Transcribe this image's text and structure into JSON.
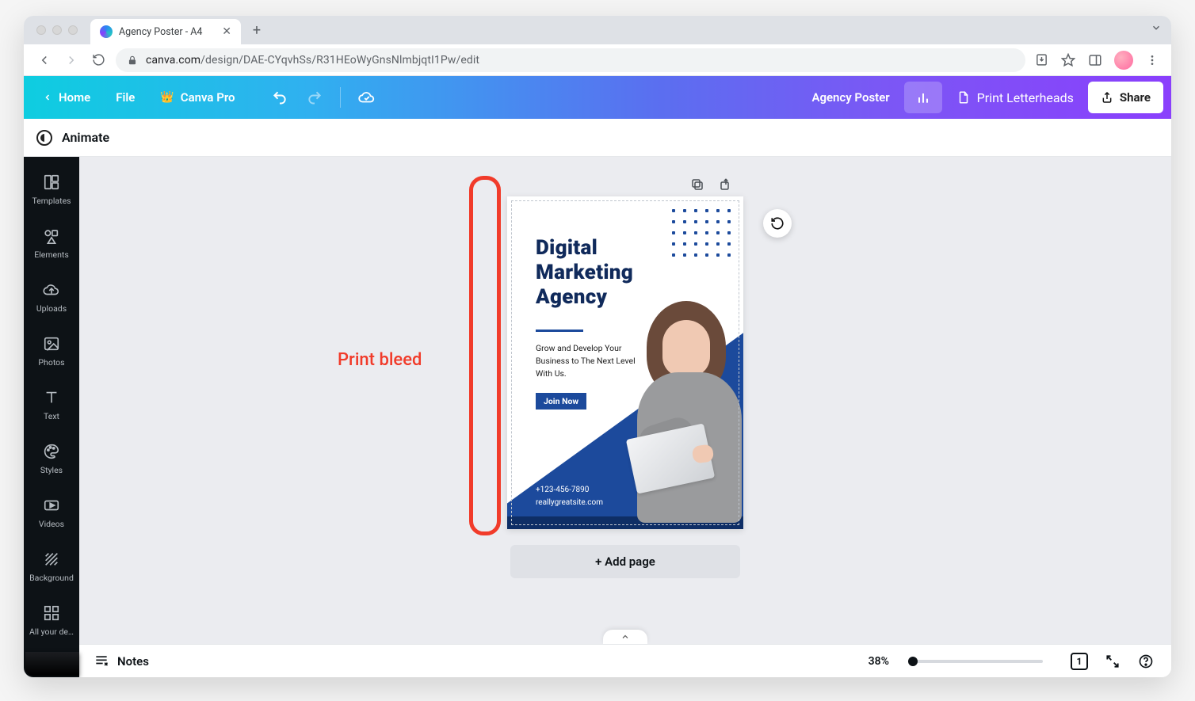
{
  "browser": {
    "tab_title": "Agency Poster - A4",
    "url_host": "canva.com",
    "url_path": "/design/DAE-CYqvhSs/R31HEoWyGnsNlmbjqtI1Pw/edit"
  },
  "topbar": {
    "home": "Home",
    "file": "File",
    "pro": "Canva Pro",
    "doc_name": "Agency Poster",
    "print": "Print Letterheads",
    "share": "Share"
  },
  "contextbar": {
    "animate": "Animate"
  },
  "sidebar": {
    "items": [
      {
        "label": "Templates"
      },
      {
        "label": "Elements"
      },
      {
        "label": "Uploads"
      },
      {
        "label": "Photos"
      },
      {
        "label": "Text"
      },
      {
        "label": "Styles"
      },
      {
        "label": "Videos"
      },
      {
        "label": "Background"
      },
      {
        "label": "All your de…"
      }
    ]
  },
  "poster": {
    "h1": "Digital",
    "h2": "Marketing",
    "h3": "Agency",
    "sub": "Grow and Develop Your Business to The Next Level With Us.",
    "cta": "Join Now",
    "phone": "+123-456-7890",
    "site": "reallygreatsite.com"
  },
  "stage": {
    "add_page": "+ Add page"
  },
  "annotation": {
    "label": "Print bleed"
  },
  "footer": {
    "notes": "Notes",
    "zoom": "38%",
    "page_count": "1"
  }
}
